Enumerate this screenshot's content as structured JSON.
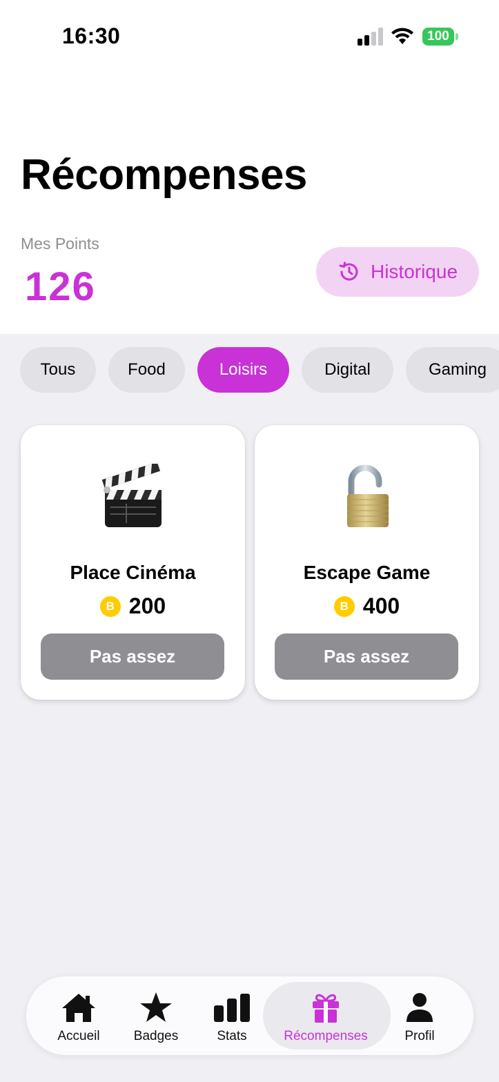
{
  "status_bar": {
    "time": "16:30",
    "battery": "100"
  },
  "header": {
    "title": "Récompenses",
    "points_label": "Mes Points",
    "points_value": "126",
    "history_label": "Historique"
  },
  "filters": [
    {
      "label": "Tous",
      "active": false
    },
    {
      "label": "Food",
      "active": false
    },
    {
      "label": "Loisirs",
      "active": true
    },
    {
      "label": "Digital",
      "active": false
    },
    {
      "label": "Gaming",
      "active": false
    }
  ],
  "rewards": [
    {
      "title": "Place Cinéma",
      "icon": "clapperboard-icon",
      "price": "200",
      "button_label": "Pas assez"
    },
    {
      "title": "Escape Game",
      "icon": "unlocked-padlock-icon",
      "price": "400",
      "button_label": "Pas assez"
    }
  ],
  "tabbar": [
    {
      "label": "Accueil",
      "icon": "house-icon",
      "active": false
    },
    {
      "label": "Badges",
      "icon": "star-icon",
      "active": false
    },
    {
      "label": "Stats",
      "icon": "bar-chart-icon",
      "active": false
    },
    {
      "label": "Récompenses",
      "icon": "gift-icon",
      "active": true
    },
    {
      "label": "Profil",
      "icon": "person-icon",
      "active": false
    }
  ],
  "colors": {
    "accent": "#c932d6",
    "accent_light": "#f3d3f4",
    "chip_bg": "#e2e2e6",
    "button_disabled": "#8e8e93",
    "coin": "#ffcc00",
    "battery": "#34c759",
    "page_bg": "#f0f0f4"
  }
}
